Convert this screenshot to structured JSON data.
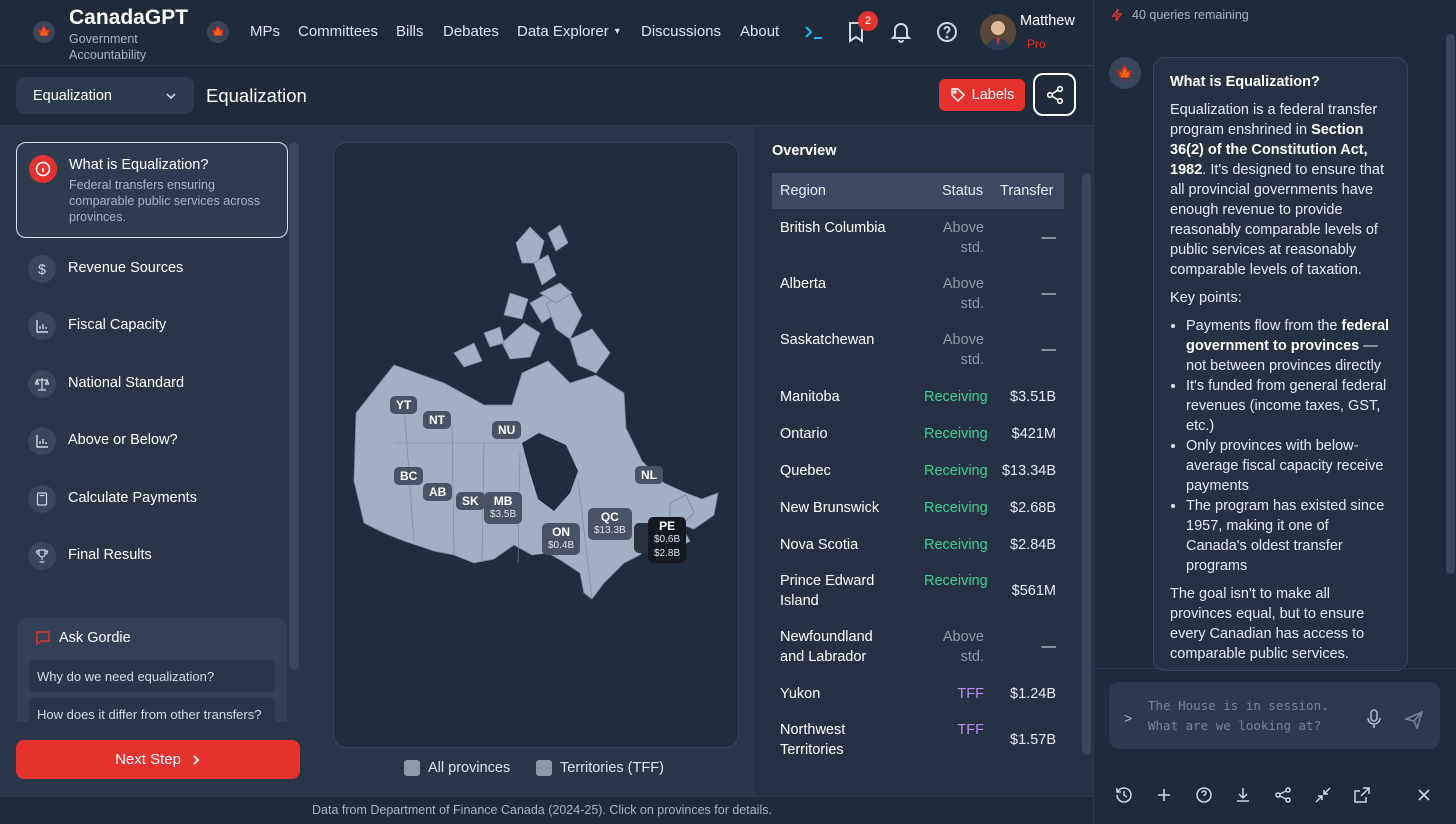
{
  "brand": {
    "title": "CanadaGPT",
    "subtitle": "Government Accountability"
  },
  "nav": {
    "items": [
      "MPs",
      "Committees",
      "Bills",
      "Debates",
      "Data Explorer",
      "Discussions",
      "About"
    ],
    "bookmark_count": "2"
  },
  "user": {
    "name": "Matthew",
    "plan": "Pro"
  },
  "subheader": {
    "topic_select": "Equalization",
    "page_title": "Equalization",
    "labels_button": "Labels"
  },
  "steps": [
    {
      "title": "What is Equalization?",
      "desc": "Federal transfers ensuring comparable public services across provinces.",
      "icon": "info-icon"
    },
    {
      "title": "Revenue Sources",
      "icon": "dollar-icon"
    },
    {
      "title": "Fiscal Capacity",
      "icon": "bar-chart-icon"
    },
    {
      "title": "National Standard",
      "icon": "scale-icon"
    },
    {
      "title": "Above or Below?",
      "icon": "bar-chart-icon"
    },
    {
      "title": "Calculate Payments",
      "icon": "calculator-icon"
    },
    {
      "title": "Final Results",
      "icon": "trophy-icon"
    }
  ],
  "ask": {
    "title": "Ask Gordie",
    "questions": [
      "Why do we need equalization?",
      "How does it differ from other transfers?"
    ]
  },
  "next_button": "Next Step",
  "map": {
    "labels": [
      {
        "code": "YT",
        "value": ""
      },
      {
        "code": "NT",
        "value": ""
      },
      {
        "code": "NU",
        "value": ""
      },
      {
        "code": "BC",
        "value": ""
      },
      {
        "code": "AB",
        "value": ""
      },
      {
        "code": "SK",
        "value": ""
      },
      {
        "code": "MB",
        "value": "$3.5B"
      },
      {
        "code": "ON",
        "value": "$0.4B"
      },
      {
        "code": "QC",
        "value": "$13.3B"
      },
      {
        "code": "NL",
        "value": ""
      },
      {
        "code": "PE",
        "value": "$0.6B",
        "value2": "$2.8B"
      }
    ],
    "legend": [
      "All provinces",
      "Territories (TFF)"
    ]
  },
  "overview": {
    "title": "Overview",
    "headers": [
      "Region",
      "Status",
      "Transfer"
    ],
    "rows": [
      {
        "region": "British Columbia",
        "status": "Above std.",
        "transfer": "—",
        "kind": "above"
      },
      {
        "region": "Alberta",
        "status": "Above std.",
        "transfer": "—",
        "kind": "above"
      },
      {
        "region": "Saskatchewan",
        "status": "Above std.",
        "transfer": "—",
        "kind": "above"
      },
      {
        "region": "Manitoba",
        "status": "Receiving",
        "transfer": "$3.51B",
        "kind": "recv"
      },
      {
        "region": "Ontario",
        "status": "Receiving",
        "transfer": "$421M",
        "kind": "recv"
      },
      {
        "region": "Quebec",
        "status": "Receiving",
        "transfer": "$13.34B",
        "kind": "recv"
      },
      {
        "region": "New Brunswick",
        "status": "Receiving",
        "transfer": "$2.68B",
        "kind": "recv"
      },
      {
        "region": "Nova Scotia",
        "status": "Receiving",
        "transfer": "$2.84B",
        "kind": "recv"
      },
      {
        "region": "Prince Edward Island",
        "status": "Receiving",
        "transfer": "$561M",
        "kind": "recv"
      },
      {
        "region": "Newfoundland and Labrador",
        "status": "Above std.",
        "transfer": "—",
        "kind": "above"
      },
      {
        "region": "Yukon",
        "status": "TFF",
        "transfer": "$1.24B",
        "kind": "tff"
      },
      {
        "region": "Northwest Territories",
        "status": "TFF",
        "transfer": "$1.57B",
        "kind": "tff"
      }
    ]
  },
  "footer": "Data from Department of Finance Canada (2024-25). Click on provinces for details.",
  "chat": {
    "quota": "40 queries remaining",
    "question": "What is Equalization?",
    "p1a": "Equalization is a federal transfer program enshrined in ",
    "p1b": "Section 36(2) of the Constitution Act, 1982",
    "p1c": ". It's designed to ensure that all provincial governments have enough revenue to provide reasonably comparable levels of public services at reasonably comparable levels of taxation.",
    "key": "Key points:",
    "b1a": "Payments flow from the ",
    "b1b": "federal government to provinces",
    "b1c": " — not between provinces directly",
    "b2": "It's funded from general federal revenues (income taxes, GST, etc.)",
    "b3": "Only provinces with below-average fiscal capacity receive payments",
    "b4": "The program has existed since 1957, making it one of Canada's oldest transfer programs",
    "p2": "The goal isn't to make all provinces equal, but to ensure every Canadian has access to comparable public services.",
    "placeholder": "The House is in session. What are we looking at?"
  },
  "colors": {
    "accent": "#e5322f",
    "receiving": "#3ecf8e",
    "tff": "#b98cf0",
    "above": "#8f99a9"
  }
}
